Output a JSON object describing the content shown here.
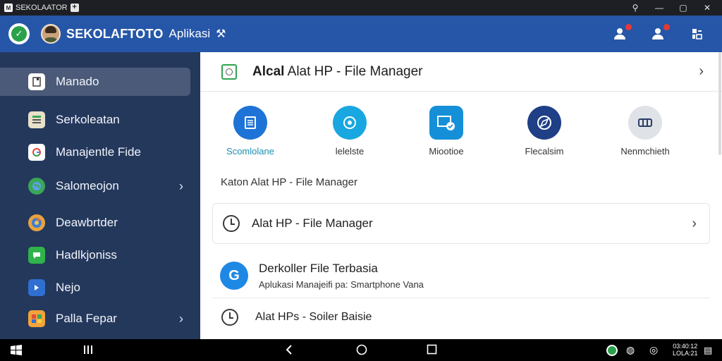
{
  "titlebar": {
    "tab_label": "SEKOLAATOR",
    "tab_logo_glyph": "M",
    "new_tab_glyph": "+"
  },
  "appbar": {
    "title": "SEKOLAFTOTO",
    "subtitle": "Aplikasi",
    "icons": [
      "check-icon",
      "avatar",
      "wrench-icon",
      "user-add-icon",
      "user-notify-icon",
      "layout-icon"
    ],
    "notification_dot_color": "#e53935",
    "background_color": "#2556a8"
  },
  "sidebar": {
    "background_color": "#24385c",
    "items": [
      {
        "label": "Manado",
        "icon": "file-icon",
        "icon_color": "#ffffff",
        "active": true,
        "has_chevron": false
      },
      {
        "label": "Serkoleatan",
        "icon": "document-icon",
        "icon_color": "#e8e0c8",
        "active": false,
        "has_chevron": false
      },
      {
        "label": "Manajentle Fide",
        "icon": "google-icon",
        "icon_color": "#ffffff",
        "active": false,
        "has_chevron": false
      },
      {
        "label": "Salomeojon",
        "icon": "globe-icon",
        "icon_color": "#3aa757",
        "active": false,
        "has_chevron": true
      },
      {
        "label": "Deawbrtder",
        "icon": "chrome-icon",
        "icon_color": "#e8a33d",
        "active": false,
        "has_chevron": false
      },
      {
        "label": "Hadlkjoniss",
        "icon": "chat-icon",
        "icon_color": "#2fb34a",
        "active": false,
        "has_chevron": false
      },
      {
        "label": "Nejo",
        "icon": "play-icon",
        "icon_color": "#2f6fd1",
        "active": false,
        "has_chevron": false
      },
      {
        "label": "Palla Fepar",
        "icon": "gallery-icon",
        "icon_color": "#f2a33a",
        "active": false,
        "has_chevron": true
      }
    ]
  },
  "main": {
    "header": {
      "title_bold": "Alcal",
      "title_rest": " Alat HP - File Manager"
    },
    "quick_actions": [
      {
        "label": "Scomlolane",
        "icon": "document-icon",
        "color": "#1e74d6"
      },
      {
        "label": "lelelste",
        "icon": "target-icon",
        "color": "#18a7e0"
      },
      {
        "label": "Miootioe",
        "icon": "folder-check-icon",
        "color": "#1590d8"
      },
      {
        "label": "Flecalsim",
        "icon": "compass-icon",
        "color": "#1f3f86"
      },
      {
        "label": "Nenmchieth",
        "icon": "box-icon",
        "color": "#dfe3e8"
      }
    ],
    "section_title": "Katon Alat HP - File Manager",
    "list_card": {
      "title": "Alat HP - File Manager",
      "icon": "clock-icon"
    },
    "row2": {
      "title": "Derkoller File Terbasia",
      "subtitle": "Aplukasi Manajeifi pa: Smartphone Vana",
      "badge_glyph": "G"
    },
    "row3": {
      "title": "Alat HPs - Soiler Baisie",
      "icon": "clock-icon"
    }
  },
  "navbar": {
    "icons": [
      "windows-icon",
      "recents-icon",
      "back-icon",
      "home-icon",
      "overview-icon",
      "status-icons"
    ],
    "tray_line1": "03:40:12",
    "tray_line2": "LOLA:21"
  }
}
